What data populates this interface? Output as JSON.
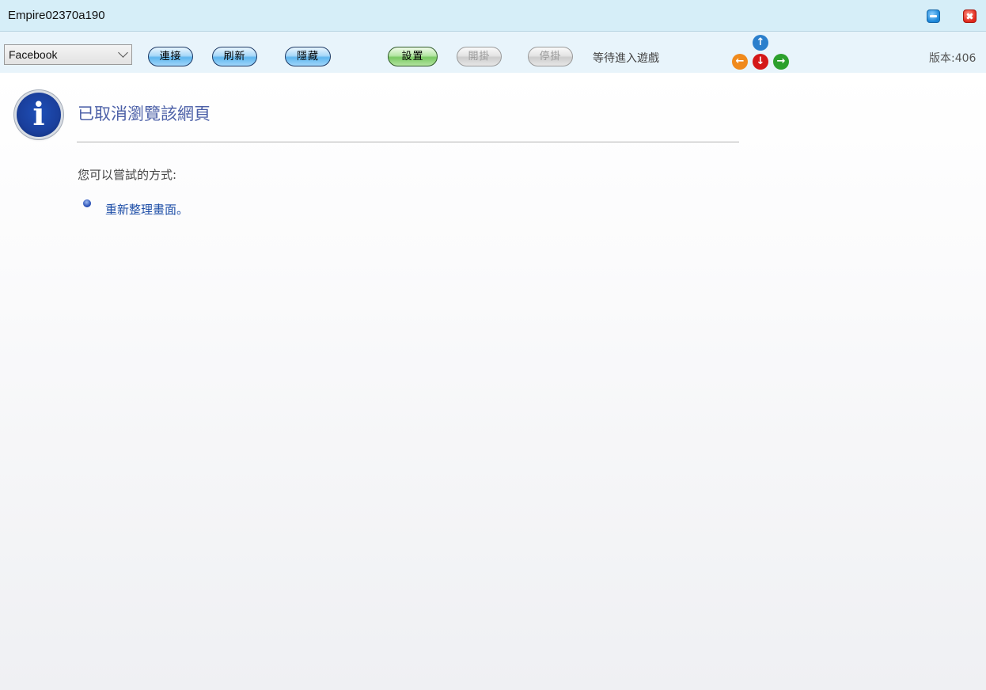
{
  "window": {
    "title": "Empire02370a190"
  },
  "toolbar": {
    "platform_select": {
      "selected": "Facebook"
    },
    "connect_label": "連接",
    "refresh_label": "刷新",
    "hide_label": "隱藏",
    "settings_label": "設置",
    "start_label": "開掛",
    "stop_label": "停掛",
    "status": "等待進入遊戲",
    "version": "版本:406",
    "arrows": {
      "up": "up-arrow-icon",
      "left": "left-arrow-icon",
      "down": "down-arrow-icon",
      "right": "right-arrow-icon"
    }
  },
  "content": {
    "icon": "info-icon",
    "heading": "已取消瀏覽該網頁",
    "subtitle": "您可以嘗試的方式:",
    "suggestions": [
      {
        "label": "重新整理畫面。"
      }
    ]
  },
  "colors": {
    "titlebar_bg": "#d6eef8",
    "toolbar_bg": "#e8f4fb",
    "heading": "#4d61a8",
    "link": "#1f4fa8"
  }
}
